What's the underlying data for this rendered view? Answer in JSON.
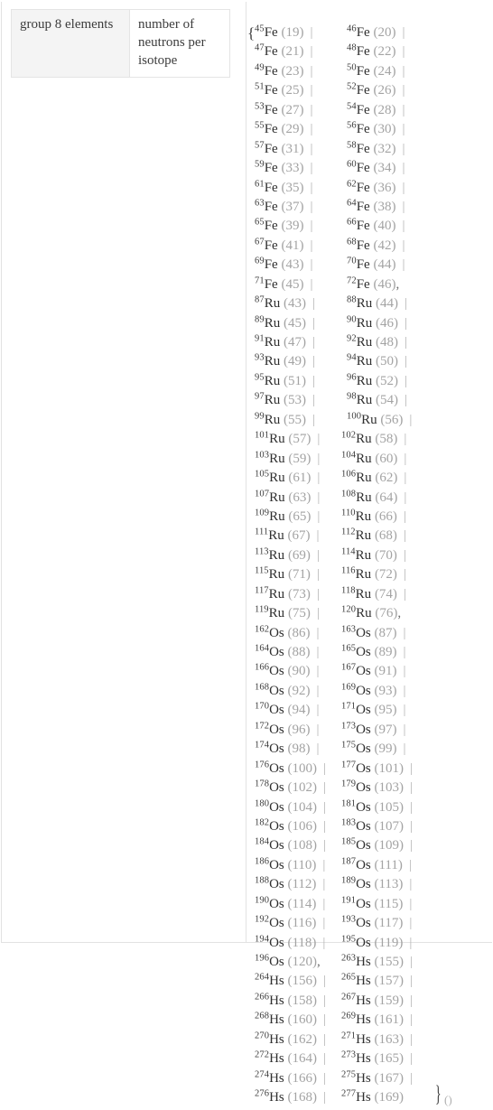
{
  "property_table": {
    "rows": [
      {
        "label": "group 8 elements",
        "value": "number of neutrons per isotope"
      }
    ]
  },
  "isotope_list": {
    "open_brace": "{",
    "close_brace": "}",
    "trailing_parens": "()",
    "separator": "|",
    "group_separator": ",",
    "neutron_open": "(",
    "neutron_close": ")",
    "lines": [
      {
        "a": {
          "mass": "45",
          "symbol": "Fe",
          "neutrons": "19",
          "sep": "|"
        },
        "b": {
          "mass": "46",
          "symbol": "Fe",
          "neutrons": "20",
          "sep": "|"
        }
      },
      {
        "a": {
          "mass": "47",
          "symbol": "Fe",
          "neutrons": "21",
          "sep": "|"
        },
        "b": {
          "mass": "48",
          "symbol": "Fe",
          "neutrons": "22",
          "sep": "|"
        }
      },
      {
        "a": {
          "mass": "49",
          "symbol": "Fe",
          "neutrons": "23",
          "sep": "|"
        },
        "b": {
          "mass": "50",
          "symbol": "Fe",
          "neutrons": "24",
          "sep": "|"
        }
      },
      {
        "a": {
          "mass": "51",
          "symbol": "Fe",
          "neutrons": "25",
          "sep": "|"
        },
        "b": {
          "mass": "52",
          "symbol": "Fe",
          "neutrons": "26",
          "sep": "|"
        }
      },
      {
        "a": {
          "mass": "53",
          "symbol": "Fe",
          "neutrons": "27",
          "sep": "|"
        },
        "b": {
          "mass": "54",
          "symbol": "Fe",
          "neutrons": "28",
          "sep": "|"
        }
      },
      {
        "a": {
          "mass": "55",
          "symbol": "Fe",
          "neutrons": "29",
          "sep": "|"
        },
        "b": {
          "mass": "56",
          "symbol": "Fe",
          "neutrons": "30",
          "sep": "|"
        }
      },
      {
        "a": {
          "mass": "57",
          "symbol": "Fe",
          "neutrons": "31",
          "sep": "|"
        },
        "b": {
          "mass": "58",
          "symbol": "Fe",
          "neutrons": "32",
          "sep": "|"
        }
      },
      {
        "a": {
          "mass": "59",
          "symbol": "Fe",
          "neutrons": "33",
          "sep": "|"
        },
        "b": {
          "mass": "60",
          "symbol": "Fe",
          "neutrons": "34",
          "sep": "|"
        }
      },
      {
        "a": {
          "mass": "61",
          "symbol": "Fe",
          "neutrons": "35",
          "sep": "|"
        },
        "b": {
          "mass": "62",
          "symbol": "Fe",
          "neutrons": "36",
          "sep": "|"
        }
      },
      {
        "a": {
          "mass": "63",
          "symbol": "Fe",
          "neutrons": "37",
          "sep": "|"
        },
        "b": {
          "mass": "64",
          "symbol": "Fe",
          "neutrons": "38",
          "sep": "|"
        }
      },
      {
        "a": {
          "mass": "65",
          "symbol": "Fe",
          "neutrons": "39",
          "sep": "|"
        },
        "b": {
          "mass": "66",
          "symbol": "Fe",
          "neutrons": "40",
          "sep": "|"
        }
      },
      {
        "a": {
          "mass": "67",
          "symbol": "Fe",
          "neutrons": "41",
          "sep": "|"
        },
        "b": {
          "mass": "68",
          "symbol": "Fe",
          "neutrons": "42",
          "sep": "|"
        }
      },
      {
        "a": {
          "mass": "69",
          "symbol": "Fe",
          "neutrons": "43",
          "sep": "|"
        },
        "b": {
          "mass": "70",
          "symbol": "Fe",
          "neutrons": "44",
          "sep": "|"
        }
      },
      {
        "a": {
          "mass": "71",
          "symbol": "Fe",
          "neutrons": "45",
          "sep": "|"
        },
        "b": {
          "mass": "72",
          "symbol": "Fe",
          "neutrons": "46",
          "sep": ","
        }
      },
      {
        "a": {
          "mass": "87",
          "symbol": "Ru",
          "neutrons": "43",
          "sep": "|"
        },
        "b": {
          "mass": "88",
          "symbol": "Ru",
          "neutrons": "44",
          "sep": "|"
        }
      },
      {
        "a": {
          "mass": "89",
          "symbol": "Ru",
          "neutrons": "45",
          "sep": "|"
        },
        "b": {
          "mass": "90",
          "symbol": "Ru",
          "neutrons": "46",
          "sep": "|"
        }
      },
      {
        "a": {
          "mass": "91",
          "symbol": "Ru",
          "neutrons": "47",
          "sep": "|"
        },
        "b": {
          "mass": "92",
          "symbol": "Ru",
          "neutrons": "48",
          "sep": "|"
        }
      },
      {
        "a": {
          "mass": "93",
          "symbol": "Ru",
          "neutrons": "49",
          "sep": "|"
        },
        "b": {
          "mass": "94",
          "symbol": "Ru",
          "neutrons": "50",
          "sep": "|"
        }
      },
      {
        "a": {
          "mass": "95",
          "symbol": "Ru",
          "neutrons": "51",
          "sep": "|"
        },
        "b": {
          "mass": "96",
          "symbol": "Ru",
          "neutrons": "52",
          "sep": "|"
        }
      },
      {
        "a": {
          "mass": "97",
          "symbol": "Ru",
          "neutrons": "53",
          "sep": "|"
        },
        "b": {
          "mass": "98",
          "symbol": "Ru",
          "neutrons": "54",
          "sep": "|"
        }
      },
      {
        "a": {
          "mass": "99",
          "symbol": "Ru",
          "neutrons": "55",
          "sep": "|"
        },
        "b": {
          "mass": "100",
          "symbol": "Ru",
          "neutrons": "56",
          "sep": "|"
        }
      },
      {
        "a": {
          "mass": "101",
          "symbol": "Ru",
          "neutrons": "57",
          "sep": "|"
        },
        "b": {
          "mass": "102",
          "symbol": "Ru",
          "neutrons": "58",
          "sep": "|"
        }
      },
      {
        "a": {
          "mass": "103",
          "symbol": "Ru",
          "neutrons": "59",
          "sep": "|"
        },
        "b": {
          "mass": "104",
          "symbol": "Ru",
          "neutrons": "60",
          "sep": "|"
        }
      },
      {
        "a": {
          "mass": "105",
          "symbol": "Ru",
          "neutrons": "61",
          "sep": "|"
        },
        "b": {
          "mass": "106",
          "symbol": "Ru",
          "neutrons": "62",
          "sep": "|"
        }
      },
      {
        "a": {
          "mass": "107",
          "symbol": "Ru",
          "neutrons": "63",
          "sep": "|"
        },
        "b": {
          "mass": "108",
          "symbol": "Ru",
          "neutrons": "64",
          "sep": "|"
        }
      },
      {
        "a": {
          "mass": "109",
          "symbol": "Ru",
          "neutrons": "65",
          "sep": "|"
        },
        "b": {
          "mass": "110",
          "symbol": "Ru",
          "neutrons": "66",
          "sep": "|"
        }
      },
      {
        "a": {
          "mass": "111",
          "symbol": "Ru",
          "neutrons": "67",
          "sep": "|"
        },
        "b": {
          "mass": "112",
          "symbol": "Ru",
          "neutrons": "68",
          "sep": "|"
        }
      },
      {
        "a": {
          "mass": "113",
          "symbol": "Ru",
          "neutrons": "69",
          "sep": "|"
        },
        "b": {
          "mass": "114",
          "symbol": "Ru",
          "neutrons": "70",
          "sep": "|"
        }
      },
      {
        "a": {
          "mass": "115",
          "symbol": "Ru",
          "neutrons": "71",
          "sep": "|"
        },
        "b": {
          "mass": "116",
          "symbol": "Ru",
          "neutrons": "72",
          "sep": "|"
        }
      },
      {
        "a": {
          "mass": "117",
          "symbol": "Ru",
          "neutrons": "73",
          "sep": "|"
        },
        "b": {
          "mass": "118",
          "symbol": "Ru",
          "neutrons": "74",
          "sep": "|"
        }
      },
      {
        "a": {
          "mass": "119",
          "symbol": "Ru",
          "neutrons": "75",
          "sep": "|"
        },
        "b": {
          "mass": "120",
          "symbol": "Ru",
          "neutrons": "76",
          "sep": ","
        }
      },
      {
        "a": {
          "mass": "162",
          "symbol": "Os",
          "neutrons": "86",
          "sep": "|"
        },
        "b": {
          "mass": "163",
          "symbol": "Os",
          "neutrons": "87",
          "sep": "|"
        }
      },
      {
        "a": {
          "mass": "164",
          "symbol": "Os",
          "neutrons": "88",
          "sep": "|"
        },
        "b": {
          "mass": "165",
          "symbol": "Os",
          "neutrons": "89",
          "sep": "|"
        }
      },
      {
        "a": {
          "mass": "166",
          "symbol": "Os",
          "neutrons": "90",
          "sep": "|"
        },
        "b": {
          "mass": "167",
          "symbol": "Os",
          "neutrons": "91",
          "sep": "|"
        }
      },
      {
        "a": {
          "mass": "168",
          "symbol": "Os",
          "neutrons": "92",
          "sep": "|"
        },
        "b": {
          "mass": "169",
          "symbol": "Os",
          "neutrons": "93",
          "sep": "|"
        }
      },
      {
        "a": {
          "mass": "170",
          "symbol": "Os",
          "neutrons": "94",
          "sep": "|"
        },
        "b": {
          "mass": "171",
          "symbol": "Os",
          "neutrons": "95",
          "sep": "|"
        }
      },
      {
        "a": {
          "mass": "172",
          "symbol": "Os",
          "neutrons": "96",
          "sep": "|"
        },
        "b": {
          "mass": "173",
          "symbol": "Os",
          "neutrons": "97",
          "sep": "|"
        }
      },
      {
        "a": {
          "mass": "174",
          "symbol": "Os",
          "neutrons": "98",
          "sep": "|"
        },
        "b": {
          "mass": "175",
          "symbol": "Os",
          "neutrons": "99",
          "sep": "|"
        }
      },
      {
        "a": {
          "mass": "176",
          "symbol": "Os",
          "neutrons": "100",
          "sep": "|"
        },
        "b": {
          "mass": "177",
          "symbol": "Os",
          "neutrons": "101",
          "sep": "|"
        }
      },
      {
        "a": {
          "mass": "178",
          "symbol": "Os",
          "neutrons": "102",
          "sep": "|"
        },
        "b": {
          "mass": "179",
          "symbol": "Os",
          "neutrons": "103",
          "sep": "|"
        }
      },
      {
        "a": {
          "mass": "180",
          "symbol": "Os",
          "neutrons": "104",
          "sep": "|"
        },
        "b": {
          "mass": "181",
          "symbol": "Os",
          "neutrons": "105",
          "sep": "|"
        }
      },
      {
        "a": {
          "mass": "182",
          "symbol": "Os",
          "neutrons": "106",
          "sep": "|"
        },
        "b": {
          "mass": "183",
          "symbol": "Os",
          "neutrons": "107",
          "sep": "|"
        }
      },
      {
        "a": {
          "mass": "184",
          "symbol": "Os",
          "neutrons": "108",
          "sep": "|"
        },
        "b": {
          "mass": "185",
          "symbol": "Os",
          "neutrons": "109",
          "sep": "|"
        }
      },
      {
        "a": {
          "mass": "186",
          "symbol": "Os",
          "neutrons": "110",
          "sep": "|"
        },
        "b": {
          "mass": "187",
          "symbol": "Os",
          "neutrons": "111",
          "sep": "|"
        }
      },
      {
        "a": {
          "mass": "188",
          "symbol": "Os",
          "neutrons": "112",
          "sep": "|"
        },
        "b": {
          "mass": "189",
          "symbol": "Os",
          "neutrons": "113",
          "sep": "|"
        }
      },
      {
        "a": {
          "mass": "190",
          "symbol": "Os",
          "neutrons": "114",
          "sep": "|"
        },
        "b": {
          "mass": "191",
          "symbol": "Os",
          "neutrons": "115",
          "sep": "|"
        }
      },
      {
        "a": {
          "mass": "192",
          "symbol": "Os",
          "neutrons": "116",
          "sep": "|"
        },
        "b": {
          "mass": "193",
          "symbol": "Os",
          "neutrons": "117",
          "sep": "|"
        }
      },
      {
        "a": {
          "mass": "194",
          "symbol": "Os",
          "neutrons": "118",
          "sep": "|"
        },
        "b": {
          "mass": "195",
          "symbol": "Os",
          "neutrons": "119",
          "sep": "|"
        }
      },
      {
        "a": {
          "mass": "196",
          "symbol": "Os",
          "neutrons": "120",
          "sep": ","
        },
        "b": {
          "mass": "263",
          "symbol": "Hs",
          "neutrons": "155",
          "sep": "|"
        }
      },
      {
        "a": {
          "mass": "264",
          "symbol": "Hs",
          "neutrons": "156",
          "sep": "|"
        },
        "b": {
          "mass": "265",
          "symbol": "Hs",
          "neutrons": "157",
          "sep": "|"
        }
      },
      {
        "a": {
          "mass": "266",
          "symbol": "Hs",
          "neutrons": "158",
          "sep": "|"
        },
        "b": {
          "mass": "267",
          "symbol": "Hs",
          "neutrons": "159",
          "sep": "|"
        }
      },
      {
        "a": {
          "mass": "268",
          "symbol": "Hs",
          "neutrons": "160",
          "sep": "|"
        },
        "b": {
          "mass": "269",
          "symbol": "Hs",
          "neutrons": "161",
          "sep": "|"
        }
      },
      {
        "a": {
          "mass": "270",
          "symbol": "Hs",
          "neutrons": "162",
          "sep": "|"
        },
        "b": {
          "mass": "271",
          "symbol": "Hs",
          "neutrons": "163",
          "sep": "|"
        }
      },
      {
        "a": {
          "mass": "272",
          "symbol": "Hs",
          "neutrons": "164",
          "sep": "|"
        },
        "b": {
          "mass": "273",
          "symbol": "Hs",
          "neutrons": "165",
          "sep": "|"
        }
      },
      {
        "a": {
          "mass": "274",
          "symbol": "Hs",
          "neutrons": "166",
          "sep": "|"
        },
        "b": {
          "mass": "275",
          "symbol": "Hs",
          "neutrons": "167",
          "sep": "|"
        }
      },
      {
        "a": {
          "mass": "276",
          "symbol": "Hs",
          "neutrons": "168",
          "sep": "|"
        },
        "b": {
          "mass": "277",
          "symbol": "Hs",
          "neutrons": "169",
          "sep": ""
        }
      }
    ]
  },
  "colors": {
    "header_cell_bg": "#f4f4f4",
    "border": "#e4e4e4",
    "text": "#3a3a3a",
    "muted": "#a3a3a3",
    "separator": "#b4b4b4"
  }
}
